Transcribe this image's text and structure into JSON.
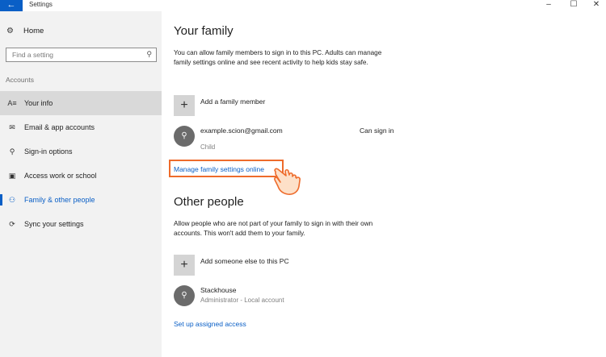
{
  "window": {
    "title": "Settings",
    "back_icon": "←",
    "minimize": "–",
    "maximize": "☐",
    "close": "✕"
  },
  "sidebar": {
    "home_label": "Home",
    "search_placeholder": "Find a setting",
    "section_label": "Accounts",
    "items": [
      {
        "label": "Your info",
        "icon": "person-card-icon",
        "glyph": "A≡"
      },
      {
        "label": "Email & app accounts",
        "icon": "mail-icon",
        "glyph": "✉"
      },
      {
        "label": "Sign-in options",
        "icon": "key-icon",
        "glyph": "⚲"
      },
      {
        "label": "Access work or school",
        "icon": "briefcase-icon",
        "glyph": "▣"
      },
      {
        "label": "Family & other people",
        "icon": "people-icon",
        "glyph": "⚇"
      },
      {
        "label": "Sync your settings",
        "icon": "sync-icon",
        "glyph": "⟳"
      }
    ]
  },
  "family": {
    "title": "Your family",
    "description": "You can allow family members to sign in to this PC. Adults can manage family settings online and see recent activity to help kids stay safe.",
    "add_label": "Add a family member",
    "member_email": "example.scion@gmail.com",
    "member_role": "Child",
    "member_status": "Can sign in",
    "manage_link": "Manage family settings online"
  },
  "other": {
    "title": "Other people",
    "description": "Allow people who are not part of your family to sign in with their own accounts. This won't add them to your family.",
    "add_label": "Add someone else to this PC",
    "user_name": "Stackhouse",
    "user_sub": "Administrator - Local account",
    "assigned_link": "Set up assigned access"
  },
  "colors": {
    "accent": "#0a5fc6",
    "highlight": "#ee6b2b",
    "sidebar_bg": "#f2f2f2"
  }
}
